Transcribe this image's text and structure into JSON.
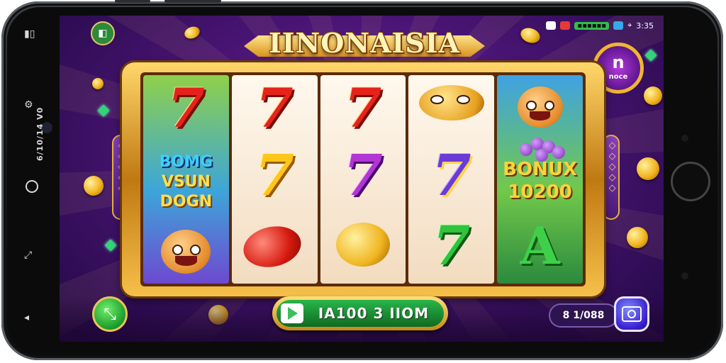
{
  "game": {
    "title": "IINONAISIA",
    "badge": {
      "glyph": "n",
      "label": "noce"
    },
    "status_bar": {
      "pill": "▪▪▪▪▪▪",
      "time": "3:35"
    },
    "side_bar": {
      "vertical_text": "6/10/14 V0"
    },
    "reels": [
      {
        "top": "7",
        "mid_text": [
          "BOMG",
          "VSUN",
          "DOGN"
        ],
        "bottom": "fish-face"
      },
      {
        "top": "7",
        "mid": "7",
        "bottom": "red-egg"
      },
      {
        "top": "7",
        "mid": "7",
        "bottom": "golden-egg"
      },
      {
        "top": "bird-face",
        "mid": "7",
        "bottom": "7"
      },
      {
        "top": "monkey-face",
        "mid_text": [
          "BONUX",
          "10200"
        ],
        "bottom": "A"
      }
    ],
    "side_pills": {
      "left": "◇◇◇◇◇",
      "right": "◇◇◇◇◇"
    },
    "spin_button": {
      "label": "IA100 3 IIOM"
    },
    "balance": {
      "label": "8 1/088"
    },
    "colors": {
      "accent_gold": "#f2b51e",
      "bg_purple": "#4a1575",
      "spin_green": "#2ab54a"
    }
  }
}
